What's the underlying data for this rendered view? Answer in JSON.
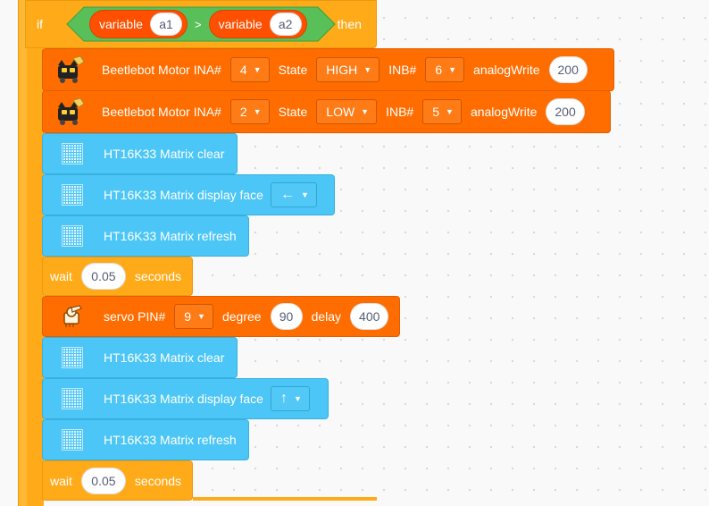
{
  "colors": {
    "motor": "#ff6d00",
    "matrix": "#4cc6f6",
    "control": "#ffab19",
    "operator": "#59c059",
    "variable": "#ff4f00"
  },
  "if_block": {
    "if_label": "if",
    "then_label": "then",
    "compare_op": ">",
    "left": {
      "label": "variable",
      "value": "a1"
    },
    "right": {
      "label": "variable",
      "value": "a2"
    }
  },
  "motor_blocks": [
    {
      "label": "Beetlebot Motor INA#",
      "ina": "4",
      "state_label": "State",
      "state": "HIGH",
      "inb_label": "INB#",
      "inb": "6",
      "aw_label": "analogWrite",
      "aw": "200",
      "icon": "robot-icon"
    },
    {
      "label": "Beetlebot Motor INA#",
      "ina": "2",
      "state_label": "State",
      "state": "LOW",
      "inb_label": "INB#",
      "inb": "5",
      "aw_label": "analogWrite",
      "aw": "200",
      "icon": "robot-icon"
    }
  ],
  "matrix": {
    "clear": "HT16K33 Matrix clear",
    "display_face": "HT16K33 Matrix display face",
    "refresh": "HT16K33 Matrix refresh",
    "face_left": "←",
    "face_up": "↑",
    "icon": "led-matrix-icon"
  },
  "wait": {
    "label": "wait",
    "value": "0.05",
    "unit": "seconds"
  },
  "servo": {
    "label": "servo PIN#",
    "pin": "9",
    "degree_label": "degree",
    "degree": "90",
    "delay_label": "delay",
    "delay": "400",
    "icon": "servo-icon"
  }
}
